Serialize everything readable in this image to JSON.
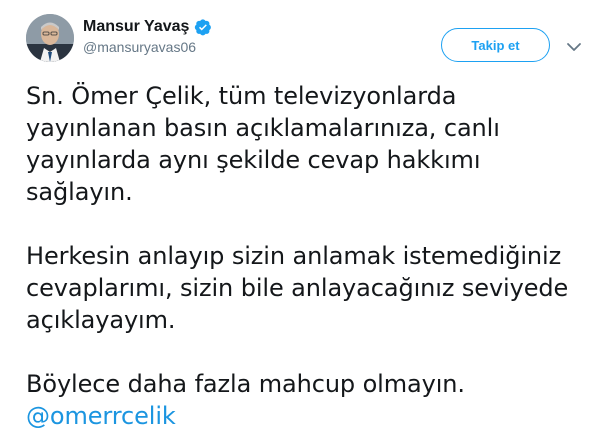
{
  "author": {
    "display_name": "Mansur Yavaş",
    "handle": "@mansuryavas06",
    "verified": true,
    "verified_icon": "verified-badge-icon",
    "avatar_icon": "profile-avatar"
  },
  "actions": {
    "follow_label": "Takip et",
    "more_icon": "chevron-down-icon"
  },
  "tweet": {
    "paragraphs": [
      "Sn. Ömer Çelik, tüm televizyonlarda\nyayınlanan basın açıklamalarınıza, canlı\nyayınlarda aynı şekilde cevap hakkımı\nsağlayın.",
      "Herkesin anlayıp sizin anlamak istemediğiniz\ncevaplarımı, sizin bile anlayacağınız seviyede\naçıklayayım.",
      "Böylece daha fazla mahcup olmayın."
    ],
    "mention": "@omerrcelik"
  },
  "colors": {
    "accent": "#1da1f2",
    "mention": "#1b95e0",
    "text": "#14171a",
    "secondary": "#657786"
  }
}
